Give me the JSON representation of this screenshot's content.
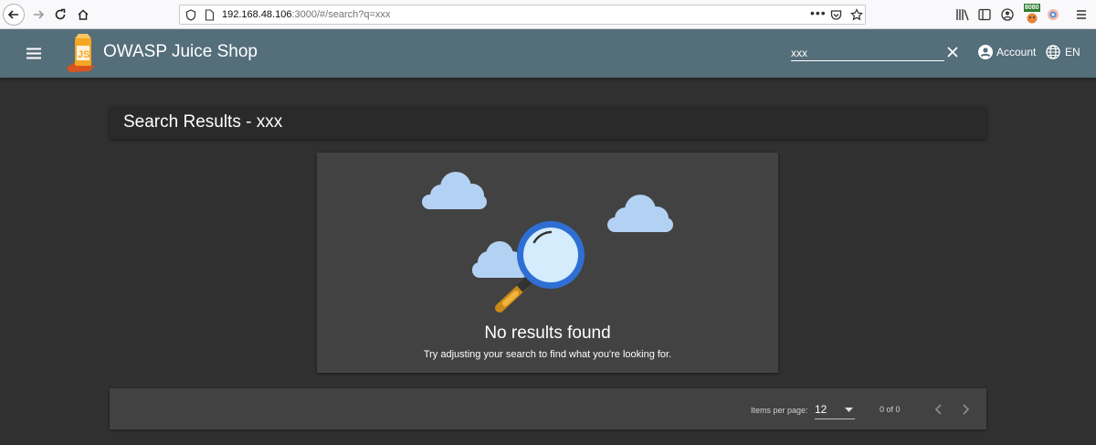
{
  "browser": {
    "url_host": "192.168.48.106",
    "url_rest": ":3000/#/search?q=xxx",
    "badge": "8080"
  },
  "app": {
    "title": "OWASP Juice Shop",
    "search_value": "xxx",
    "account_label": "Account",
    "language_label": "EN"
  },
  "results": {
    "title": "Search Results - xxx",
    "empty_title": "No results found",
    "empty_subtitle": "Try adjusting your search to find what you're looking for."
  },
  "paginator": {
    "items_per_page_label": "Items per page:",
    "items_per_page_value": "12",
    "range_label": "0 of 0"
  },
  "colors": {
    "toolbar": "#546e7a",
    "background": "#303030",
    "card": "#424242"
  }
}
